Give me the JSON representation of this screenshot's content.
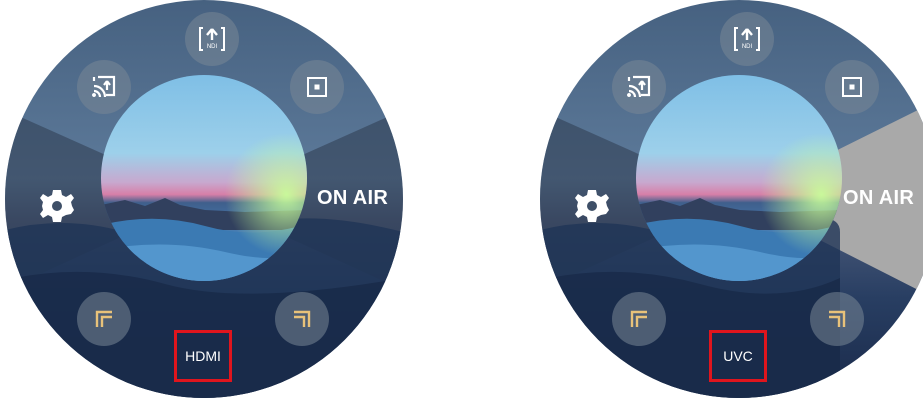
{
  "panels": [
    {
      "id": "left",
      "onair_label": "ON AIR",
      "onair_active": false,
      "source_label": "HDMI",
      "ndi_badge": "NDI"
    },
    {
      "id": "right",
      "onair_label": "ON AIR",
      "onair_active": true,
      "source_label": "UVC",
      "ndi_badge": "NDI"
    }
  ],
  "icons": {
    "ndi": "ndi-upload-icon",
    "cast": "screen-cast-icon",
    "stop": "stop-icon",
    "settings": "gear-icon",
    "frame_left": "frame-corner-left-icon",
    "frame_right": "frame-corner-right-icon"
  },
  "colors": {
    "highlight_border": "#e0151d",
    "onair_active_sector": "#a9a9a9",
    "frame_corner_accent": "#e8c27a"
  }
}
